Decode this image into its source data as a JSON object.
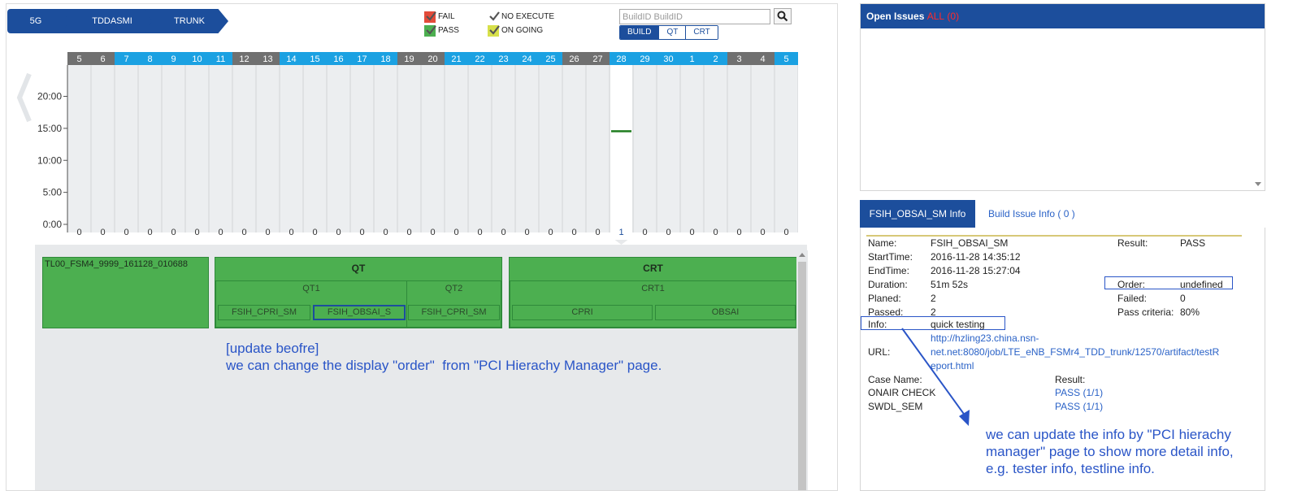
{
  "breadcrumb": [
    "5G",
    "TDDASMI",
    "TRUNK"
  ],
  "legend": {
    "fail": "FAIL",
    "pass": "PASS",
    "no_execute": "NO EXECUTE",
    "on_going": "ON GOING"
  },
  "colors": {
    "fail": "#e34b3a",
    "pass": "#4caf50",
    "no_execute": "#666666",
    "on_going": "#c8d34a",
    "primary": "#1c4e9c",
    "day_blue": "#1ba1e2",
    "day_gray": "#707070"
  },
  "search": {
    "value": "",
    "placeholder": "BuildID BuildID",
    "icon": "search-icon"
  },
  "mode_buttons": [
    "BUILD",
    "QT",
    "CRT"
  ],
  "chart_data": {
    "type": "bar",
    "categories": [
      "5",
      "6",
      "7",
      "8",
      "9",
      "10",
      "11",
      "12",
      "13",
      "14",
      "15",
      "16",
      "17",
      "18",
      "19",
      "20",
      "21",
      "22",
      "23",
      "24",
      "25",
      "26",
      "27",
      "28",
      "29",
      "30",
      "1",
      "2",
      "3",
      "4",
      "5"
    ],
    "category_style": [
      "gray",
      "gray",
      "blue",
      "blue",
      "blue",
      "blue",
      "blue",
      "gray",
      "gray",
      "blue",
      "blue",
      "blue",
      "blue",
      "blue",
      "gray",
      "gray",
      "blue",
      "blue",
      "blue",
      "blue",
      "blue",
      "gray",
      "gray",
      "blue",
      "blue",
      "blue",
      "blue",
      "blue",
      "gray",
      "gray",
      "blue"
    ],
    "selected_index": 23,
    "counts": [
      0,
      0,
      0,
      0,
      0,
      0,
      0,
      0,
      0,
      0,
      0,
      0,
      0,
      0,
      0,
      0,
      0,
      0,
      0,
      0,
      0,
      0,
      0,
      1,
      0,
      0,
      0,
      0,
      0,
      0,
      0
    ],
    "marks": [
      {
        "category_index": 23,
        "time_hours": 14.58,
        "status": "pass"
      }
    ],
    "y_ticks": [
      "0:00",
      "5:00",
      "10:00",
      "15:00",
      "20:00"
    ],
    "ylim": [
      0,
      24
    ]
  },
  "tree": {
    "build": "TL00_FSM4_9999_161128_010688",
    "groups": [
      {
        "name": "QT",
        "subs": [
          {
            "name": "QT1",
            "cases": [
              "FSIH_CPRI_SM",
              "FSIH_OBSAI_S"
            ]
          },
          {
            "name": "QT2",
            "cases": [
              "FSIH_CPRI_SM"
            ]
          }
        ]
      },
      {
        "name": "CRT",
        "subs": [
          {
            "name": "CRT1",
            "cases": [
              "CPRI",
              "OBSAI"
            ]
          }
        ]
      }
    ]
  },
  "annotation_left": {
    "line1": "[update beofre]",
    "line2": "we can change the display \"order\"  from \"PCI Hierachy Manager\" page."
  },
  "annotation_right": {
    "line1": "we can update the info by \"PCI hierachy",
    "line2": "manager\" page to show more detail info,",
    "line3": "e.g. tester info, testline info."
  },
  "open_issues": {
    "title": "Open Issues",
    "filter": "ALL",
    "count": "(0)"
  },
  "tabs": {
    "active": "FSIH_OBSAI_SM Info",
    "other": "Build Issue Info ( 0 )"
  },
  "info": {
    "name_label": "Name:",
    "name": "FSIH_OBSAI_SM",
    "result_label": "Result:",
    "result": "PASS",
    "start_label": "StartTime:",
    "start": "2016-11-28 14:35:12",
    "end_label": "EndTime:",
    "end": "2016-11-28 15:27:04",
    "duration_label": "Duration:",
    "duration": "51m 52s",
    "order_label": "Order:",
    "order": "undefined",
    "planed_label": "Planed:",
    "planed": "2",
    "failed_label": "Failed:",
    "failed": "0",
    "passed_label": "Passed:",
    "passed": "2",
    "criteria_label": "Pass criteria:",
    "criteria": "80%",
    "info_label": "Info:",
    "info": "quick testing",
    "url_label": "URL:",
    "url_l1": "http://hzling23.china.nsn-",
    "url_l2": "net.net:8080/job/LTE_eNB_FSMr4_TDD_trunk/12570/artifact/testR",
    "url_l3": "eport.html",
    "case_name_label": "Case Name:",
    "case_result_label": "Result:",
    "cases": [
      {
        "name": "ONAIR CHECK",
        "result": "PASS (1/1)"
      },
      {
        "name": "SWDL_SEM",
        "result": "PASS (1/1)"
      }
    ]
  }
}
